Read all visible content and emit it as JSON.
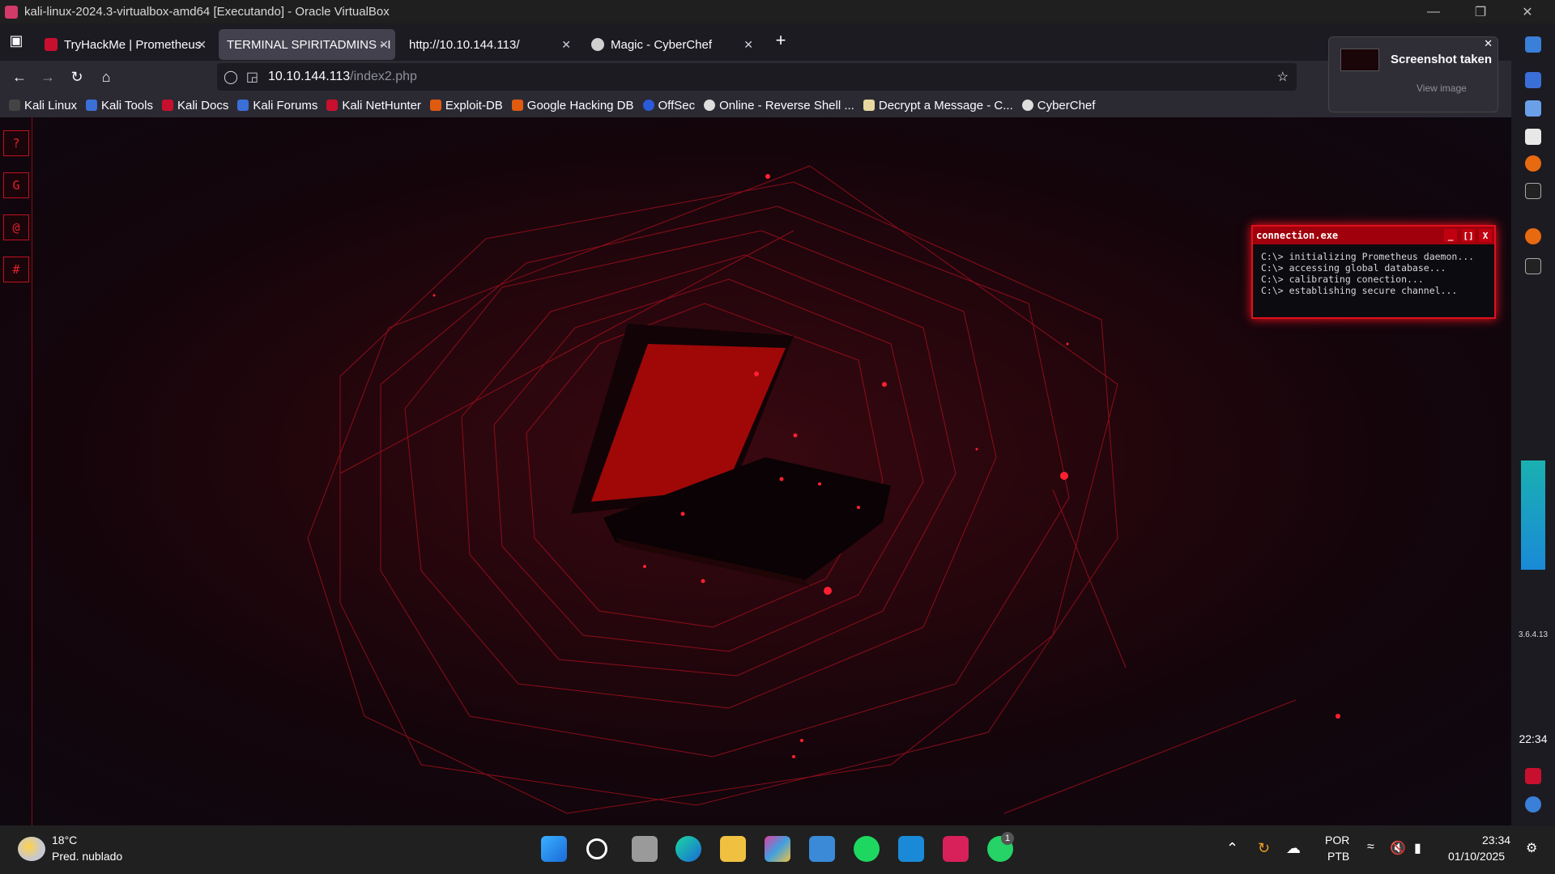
{
  "window": {
    "title": "kali-linux-2024.3-virtualbox-amd64 [Executando] - Oracle VirtualBox"
  },
  "tabs": [
    {
      "label": "TryHackMe | Prometheus",
      "active": false
    },
    {
      "label": "TERMINAL SPIRITADMINS - I",
      "active": true
    },
    {
      "label": "http://10.10.144.113/",
      "active": false
    },
    {
      "label": "Magic - CyberChef",
      "active": false
    }
  ],
  "address": {
    "host": "10.10.144.113",
    "path": "/index2.php"
  },
  "bookmarks": [
    "Kali Linux",
    "Kali Tools",
    "Kali Docs",
    "Kali Forums",
    "Kali NetHunter",
    "Exploit-DB",
    "Google Hacking DB",
    "OffSec",
    "Online - Reverse Shell ...",
    "Decrypt a Message - C...",
    "CyberChef"
  ],
  "page_sidebar": [
    "?",
    "G",
    "@",
    "#"
  ],
  "terminal": {
    "title": "connection.exe",
    "btn_min": "_",
    "btn_max": "[]",
    "btn_close": "X",
    "lines": [
      "C:\\> initializing Prometheus daemon...",
      "C:\\> accessing global database...",
      "C:\\> calibrating conection...",
      "C:\\> establishing secure channel..."
    ]
  },
  "screenshot_notice": {
    "title": "Screenshot taken",
    "action": "View image"
  },
  "ff_sidebar": {
    "ip": "3.6.4.13",
    "time": "22:34"
  },
  "taskbar": {
    "temp": "18°C",
    "weather": "Pred. nublado",
    "lang1": "POR",
    "lang2": "PTB",
    "time": "23:34",
    "date": "01/10/2025",
    "whatsapp_badge": "1"
  },
  "colors": {
    "accent": "#e0101c",
    "page_bg": "#14050b"
  },
  "icons": {
    "new_tab": "plus-icon",
    "back": "back-arrow-icon",
    "forward": "forward-arrow-icon",
    "reload": "reload-icon",
    "home": "home-icon",
    "bookmark": "star-icon"
  }
}
